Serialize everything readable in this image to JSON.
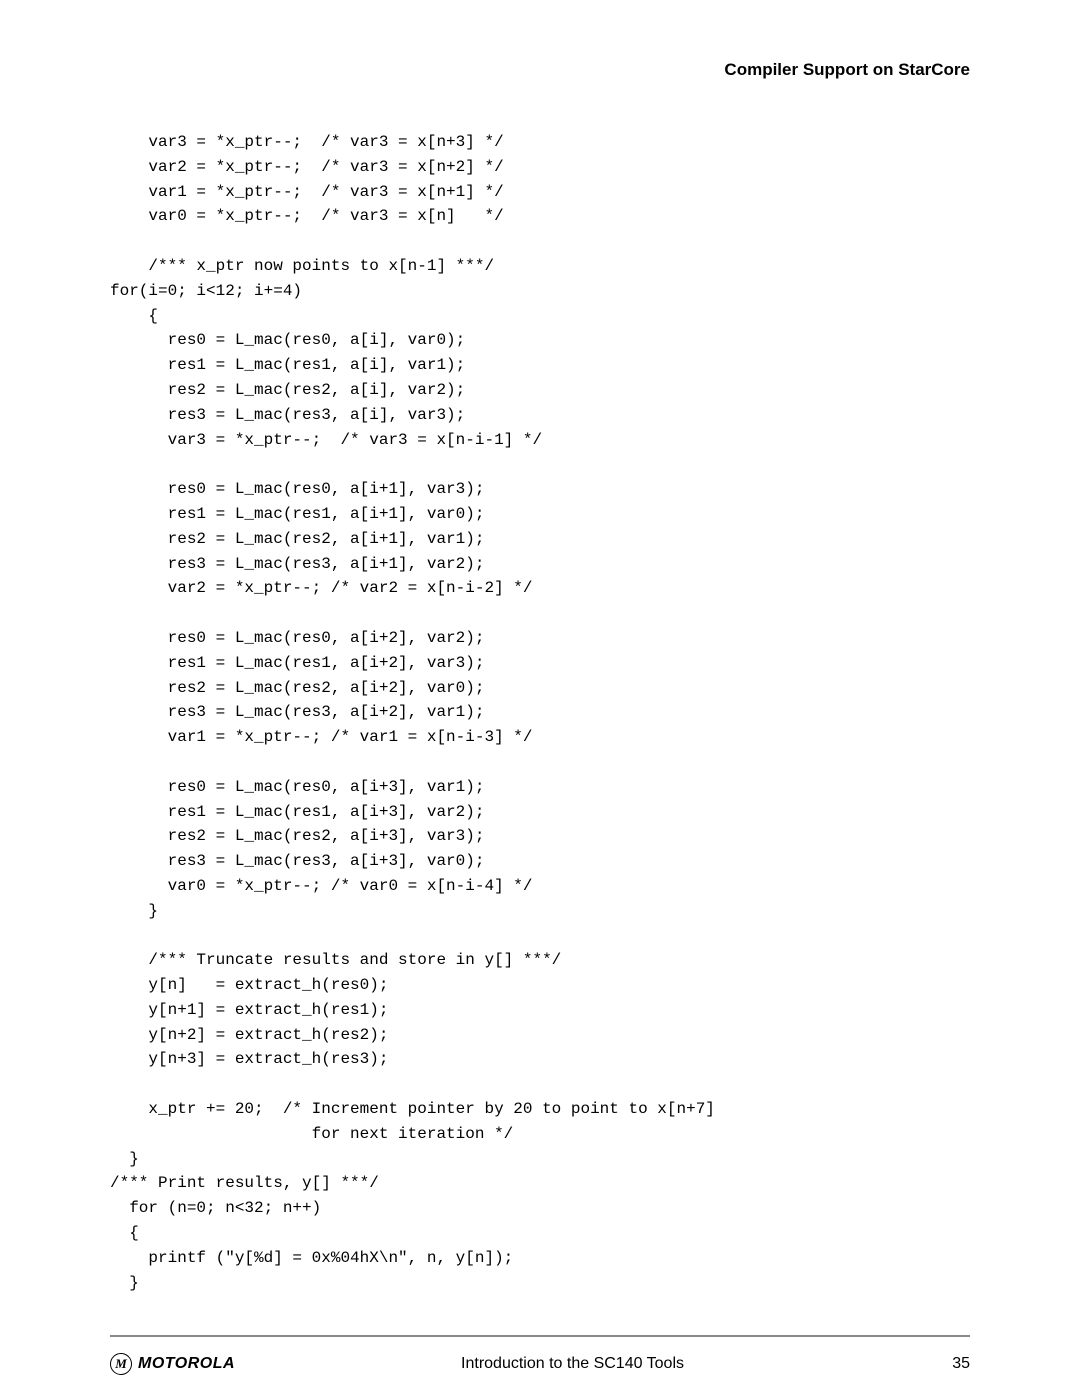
{
  "section_header": "Compiler Support on StarCore",
  "code": "    var3 = *x_ptr--;  /* var3 = x[n+3] */\n    var2 = *x_ptr--;  /* var3 = x[n+2] */\n    var1 = *x_ptr--;  /* var3 = x[n+1] */\n    var0 = *x_ptr--;  /* var3 = x[n]   */\n\n    /*** x_ptr now points to x[n-1] ***/\nfor(i=0; i<12; i+=4)\n    {\n      res0 = L_mac(res0, a[i], var0);\n      res1 = L_mac(res1, a[i], var1);\n      res2 = L_mac(res2, a[i], var2);\n      res3 = L_mac(res3, a[i], var3);\n      var3 = *x_ptr--;  /* var3 = x[n-i-1] */\n\n      res0 = L_mac(res0, a[i+1], var3);\n      res1 = L_mac(res1, a[i+1], var0);\n      res2 = L_mac(res2, a[i+1], var1);\n      res3 = L_mac(res3, a[i+1], var2);\n      var2 = *x_ptr--; /* var2 = x[n-i-2] */\n\n      res0 = L_mac(res0, a[i+2], var2);\n      res1 = L_mac(res1, a[i+2], var3);\n      res2 = L_mac(res2, a[i+2], var0);\n      res3 = L_mac(res3, a[i+2], var1);\n      var1 = *x_ptr--; /* var1 = x[n-i-3] */\n\n      res0 = L_mac(res0, a[i+3], var1);\n      res1 = L_mac(res1, a[i+3], var2);\n      res2 = L_mac(res2, a[i+3], var3);\n      res3 = L_mac(res3, a[i+3], var0);\n      var0 = *x_ptr--; /* var0 = x[n-i-4] */\n    }\n\n    /*** Truncate results and store in y[] ***/\n    y[n]   = extract_h(res0);\n    y[n+1] = extract_h(res1);\n    y[n+2] = extract_h(res2);\n    y[n+3] = extract_h(res3);\n\n    x_ptr += 20;  /* Increment pointer by 20 to point to x[n+7]\n                     for next iteration */\n  }\n/*** Print results, y[] ***/\n  for (n=0; n<32; n++)\n  {\n    printf (\"y[%d] = 0x%04hX\\n\", n, y[n]);\n  }",
  "footer": {
    "logo_letter": "M",
    "brand": "MOTOROLA",
    "title": "Introduction to the SC140 Tools",
    "page": "35"
  }
}
